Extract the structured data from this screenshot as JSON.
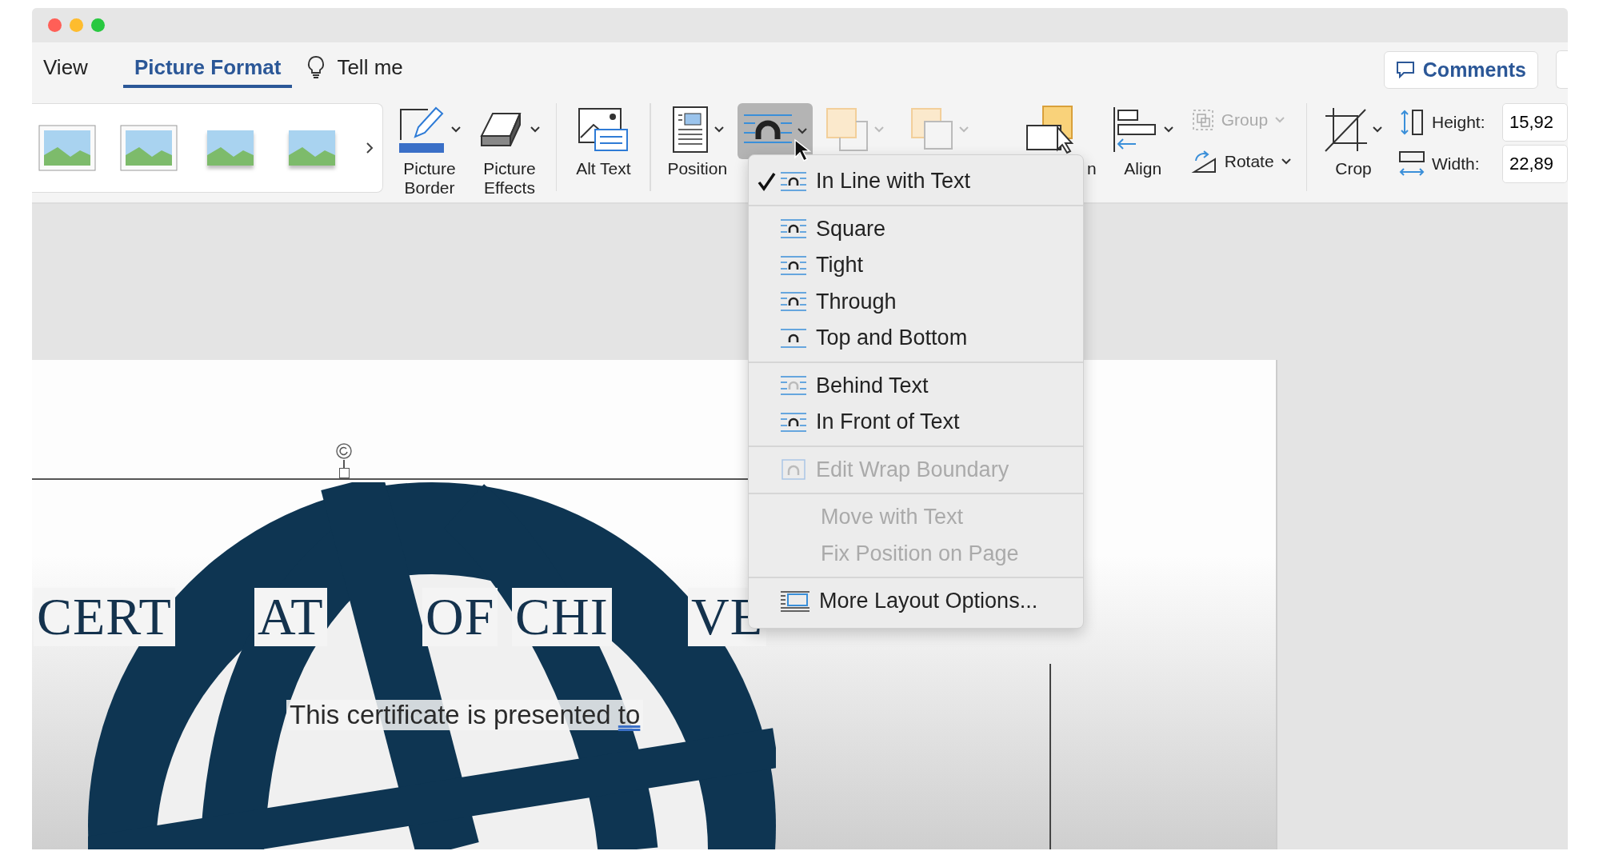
{
  "tabs": [
    {
      "label": "View",
      "selected": false
    },
    {
      "label": "Picture Format",
      "selected": true
    }
  ],
  "tell_me": "Tell me",
  "comments_button": "Comments",
  "ribbon": {
    "picture_border": "Picture Border",
    "picture_effects": "Picture Effects",
    "alt_text": "Alt Text",
    "position": "Position",
    "wrap_text_open": true,
    "bring_forward_label": "n",
    "align": "Align",
    "group": {
      "label": "Group",
      "disabled": true
    },
    "rotate": "Rotate",
    "crop": "Crop",
    "height_label": "Height:",
    "height_value": "15,92",
    "width_label": "Width:",
    "width_value": "22,89"
  },
  "wrap_menu": [
    [
      {
        "label": "In Line with Text",
        "kind": "wrap",
        "checked": true,
        "disabled": false
      }
    ],
    [
      {
        "label": "Square",
        "kind": "wrap",
        "checked": false,
        "disabled": false
      },
      {
        "label": "Tight",
        "kind": "wrap",
        "checked": false,
        "disabled": false
      },
      {
        "label": "Through",
        "kind": "wrap",
        "checked": false,
        "disabled": false
      },
      {
        "label": "Top and Bottom",
        "kind": "wrap",
        "checked": false,
        "disabled": false
      }
    ],
    [
      {
        "label": "Behind Text",
        "kind": "wrap",
        "checked": false,
        "disabled": false
      },
      {
        "label": "In Front of Text",
        "kind": "wrap",
        "checked": false,
        "disabled": false
      }
    ],
    [
      {
        "label": "Edit Wrap Boundary",
        "kind": "boundary",
        "checked": false,
        "disabled": true
      }
    ],
    [
      {
        "label": "Move with Text",
        "kind": "plain",
        "checked": false,
        "disabled": true
      },
      {
        "label": "Fix Position on Page",
        "kind": "plain",
        "checked": false,
        "disabled": true
      }
    ],
    [
      {
        "label": "More Layout Options...",
        "kind": "layout",
        "checked": false,
        "disabled": false
      }
    ]
  ],
  "document": {
    "title_fragments": [
      "CERT",
      "AT",
      "OF",
      "CHI",
      "VE"
    ],
    "subtitle": "This certificate is presented",
    "flagged_word": "to"
  }
}
